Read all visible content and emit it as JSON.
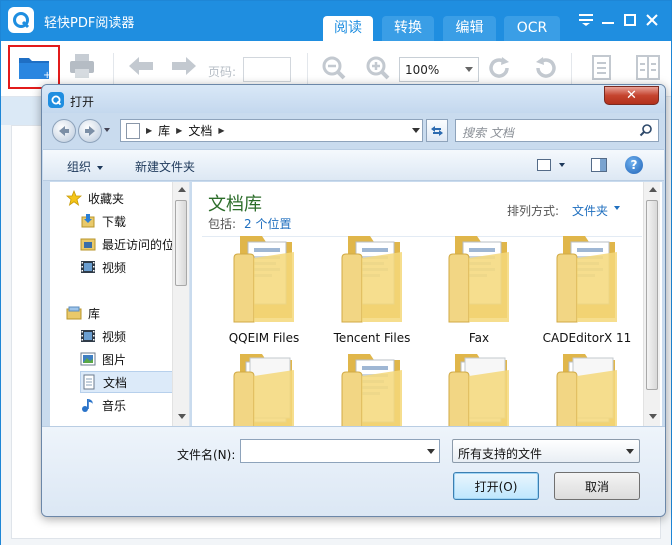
{
  "app": {
    "title": "轻快PDF阅读器",
    "tabs": [
      {
        "label": "阅读",
        "active": true
      },
      {
        "label": "转换",
        "active": false
      },
      {
        "label": "编辑",
        "active": false
      },
      {
        "label": "OCR",
        "active": false
      }
    ],
    "accent_color": "#1f8ee0"
  },
  "toolbar": {
    "page_label": "页码:",
    "page_value": "",
    "zoom_value": "100%",
    "icons": [
      "open-folder-icon",
      "print-icon",
      "arrow-left-icon",
      "arrow-right-icon",
      "zoom-out-icon",
      "zoom-in-icon",
      "rotate-left-icon",
      "rotate-right-icon",
      "single-page-icon",
      "double-page-icon"
    ]
  },
  "dialog": {
    "title": "打开",
    "close_symbol": "✕",
    "breadcrumb": [
      "库",
      "文档"
    ],
    "search_placeholder": "搜索 文档",
    "command_bar": {
      "organize": "组织",
      "new_folder": "新建文件夹"
    },
    "nav": {
      "favorites_header": "收藏夹",
      "favorites": [
        "下载",
        "最近访问的位",
        "视频"
      ],
      "libraries_header": "库",
      "libraries": [
        "视频",
        "图片",
        "文档",
        "音乐"
      ],
      "selected": "文档"
    },
    "library": {
      "title": "文档库",
      "includes_label": "包括:",
      "locations_link": "2 个位置",
      "arrange_label": "排列方式:",
      "arrange_value": "文件夹"
    },
    "folders": [
      {
        "name": "QQEIM Files"
      },
      {
        "name": "Tencent Files"
      },
      {
        "name": "Fax"
      },
      {
        "name": "CADEditorX 11"
      },
      {
        "name": ""
      },
      {
        "name": ""
      },
      {
        "name": ""
      },
      {
        "name": ""
      }
    ],
    "filename_label": "文件名(N):",
    "filename_value": "",
    "filetype_value": "所有支持的文件",
    "open_button": "打开(O)",
    "cancel_button": "取消"
  }
}
